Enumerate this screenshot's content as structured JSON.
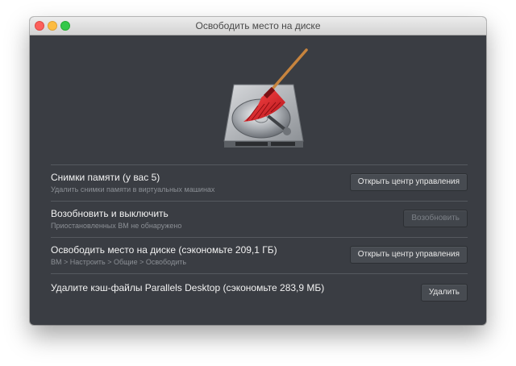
{
  "window": {
    "title": "Освободить место на диске"
  },
  "rows": [
    {
      "title": "Снимки памяти (у вас 5)",
      "subtitle": "Удалить снимки памяти в виртуальных машинах",
      "button": "Открыть центр управления",
      "button_enabled": true
    },
    {
      "title": "Возобновить и выключить",
      "subtitle": "Приостановленных ВМ не обнаружено",
      "button": "Возобновить",
      "button_enabled": false
    },
    {
      "title": "Освободить место на диске (сэкономьте 209,1 ГБ)",
      "subtitle": "ВМ > Настроить > Общие > Освободить",
      "button": "Открыть центр управления",
      "button_enabled": true
    },
    {
      "title": "Удалите кэш-файлы Parallels Desktop (сэкономьте 283,9 МБ)",
      "subtitle": "",
      "button": "Удалить",
      "button_enabled": true
    }
  ],
  "icons": {
    "hero": "hard-drive-broom-icon"
  },
  "colors": {
    "window_bg": "#3a3d43",
    "accent_red": "#e01f26"
  }
}
